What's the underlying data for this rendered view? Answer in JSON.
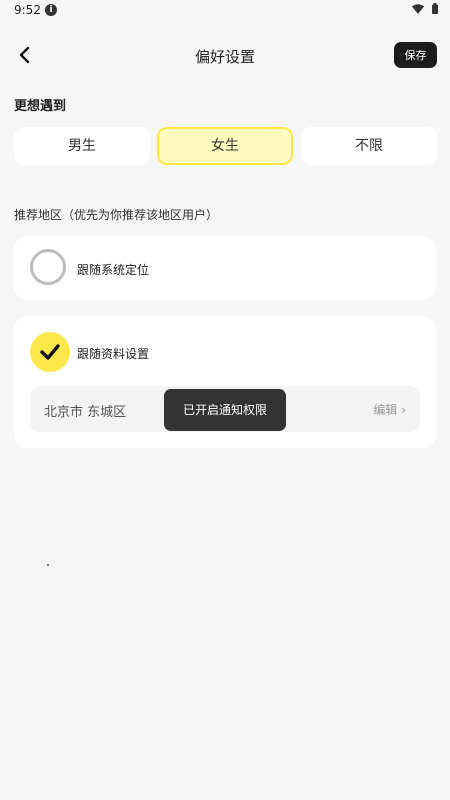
{
  "status_bar": {
    "time": "9:52",
    "info_icon": "i"
  },
  "header": {
    "title": "偏好设置",
    "save_label": "保存",
    "back_icon": "chevron-left-icon"
  },
  "meet_section": {
    "label": "更想遇到",
    "options": [
      {
        "label": "男生",
        "selected": false
      },
      {
        "label": "女生",
        "selected": true
      },
      {
        "label": "不限",
        "selected": false
      }
    ]
  },
  "region_section": {
    "label": "推荐地区（优先为你推荐该地区用户）",
    "system_location": {
      "label": "跟随系统定位",
      "selected": false
    },
    "profile_location": {
      "label": "跟随资料设置",
      "selected": true,
      "location": "北京市 东城区",
      "edit_label": "编辑 ›"
    }
  },
  "toast": {
    "message": "已开启通知权限"
  },
  "colors": {
    "accent": "#ffe74a",
    "selected_bg": "#fffac0",
    "save_bg": "#1c1c1c",
    "toast_bg": "#333333",
    "page_bg": "#f6f6f6"
  }
}
